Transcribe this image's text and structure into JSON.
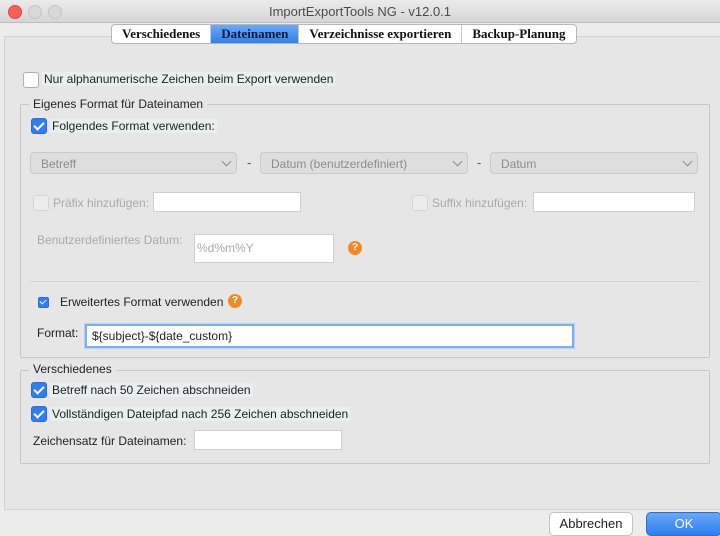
{
  "window": {
    "title": "ImportExportTools NG - v12.0.1"
  },
  "tabs": [
    "Verschiedenes",
    "Dateinamen",
    "Verzeichnisse exportieren",
    "Backup-Planung"
  ],
  "alnum_export": {
    "label": "Nur alphanumerische Zeichen beim Export verwenden",
    "checked": false
  },
  "custom_format": {
    "legend": "Eigenes Format für Dateinamen",
    "use_format": {
      "label": "Folgendes Format verwenden:",
      "checked": true
    },
    "selects": [
      "Betreff",
      "Datum (benutzerdefiniert)",
      "Datum"
    ],
    "separator": "-",
    "prefix": {
      "label": "Präfix hinzufügen:",
      "value": ""
    },
    "suffix": {
      "label": "Suffix hinzufügen:",
      "value": ""
    },
    "custom_date": {
      "label": "Benutzerdefiniertes Datum:",
      "value": "%d%m%Y"
    },
    "help_glyph": "?",
    "extended": {
      "label": "Erweitertes Format verwenden",
      "checked": true
    },
    "format": {
      "label": "Format:",
      "value": "${subject}-${date_custom}"
    }
  },
  "misc": {
    "legend": "Verschiedenes",
    "truncate_subject": {
      "label": "Betreff nach 50 Zeichen abschneiden",
      "checked": true
    },
    "truncate_path": {
      "label": "Vollständigen Dateipfad nach 256 Zeichen abschneiden",
      "checked": true
    },
    "charset": {
      "label": "Zeichensatz für Dateinamen:",
      "value": ""
    }
  },
  "buttons": {
    "cancel": "Abbrechen",
    "ok": "OK"
  },
  "colors": {
    "accent": "#2e7cf6",
    "help": "#f08a24"
  }
}
